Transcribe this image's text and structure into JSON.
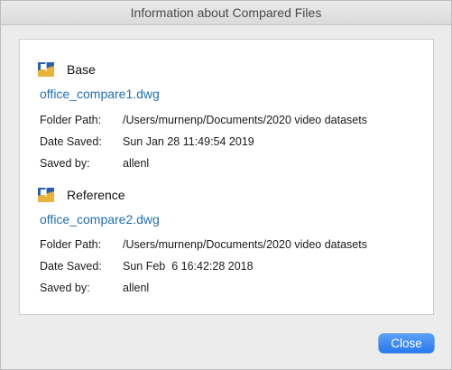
{
  "window": {
    "title": "Information about Compared Files"
  },
  "base": {
    "heading": "Base",
    "file_name": "office_compare1.dwg",
    "folder_label": "Folder Path:",
    "folder_value": "/Users/murnenp/Documents/2020 video datasets",
    "date_label": "Date Saved:",
    "date_value": "Sun Jan 28 11:49:54 2019",
    "saved_by_label": "Saved by:",
    "saved_by_value": "allenl",
    "icon": "dwg-file-icon"
  },
  "reference": {
    "heading": "Reference",
    "file_name": "office_compare2.dwg",
    "folder_label": "Folder Path:",
    "folder_value": "/Users/murnenp/Documents/2020 video datasets",
    "date_label": "Date Saved:",
    "date_value": "Sun Feb  6 16:42:28 2018",
    "saved_by_label": "Saved by:",
    "saved_by_value": "allenl",
    "icon": "dwg-file-icon"
  },
  "buttons": {
    "close_label": "Close"
  },
  "colors": {
    "link": "#1f6fb2",
    "button": "#2779ee"
  }
}
